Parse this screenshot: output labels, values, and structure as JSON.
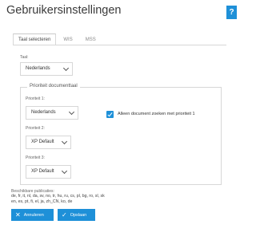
{
  "header": {
    "title": "Gebruikersinstellingen",
    "help_label": "?"
  },
  "tabs": [
    {
      "label": "Taal selecteren",
      "active": true
    },
    {
      "label": "WIS",
      "active": false
    },
    {
      "label": "MSS",
      "active": false
    }
  ],
  "language": {
    "label": "Taal:",
    "value": "Nederlands"
  },
  "priority": {
    "legend": "Prioriteit documenttaal",
    "p1": {
      "label": "Prioriteit 1:",
      "value": "Nederlands"
    },
    "p2": {
      "label": "Prioriteit 2:",
      "value": "XP Default"
    },
    "p3": {
      "label": "Prioriteit 3:",
      "value": "XP Default"
    },
    "checkbox": {
      "label": "Alleen document zoeken met prioriteit 1",
      "checked": true
    }
  },
  "publications": {
    "label": "Beschikbare publicaties:",
    "line1": "de, fr, it, nl, da, sv, no, tr, hu, ru, cs, pl, bg, ro, sl, sk",
    "line2": "en, es, pt, fi, el, ja, zh_CN, ko, de"
  },
  "buttons": {
    "cancel": "Annuleren",
    "save": "Opslaan"
  },
  "colors": {
    "accent": "#1e90d8",
    "border": "#d7d7d7"
  }
}
